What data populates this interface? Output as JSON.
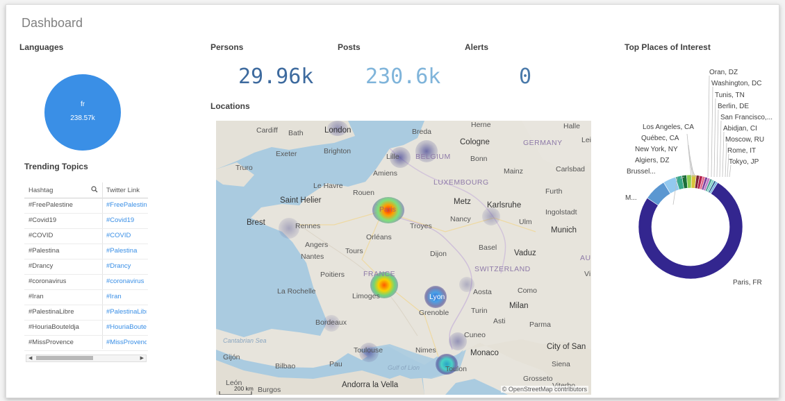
{
  "dashboard": {
    "title": "Dashboard"
  },
  "languages": {
    "heading": "Languages",
    "lang": "fr",
    "value": "238.57k",
    "color": "#3a8fe6"
  },
  "kpis": {
    "persons": {
      "label": "Persons",
      "value": "29.96k",
      "color": "#3d6a9e"
    },
    "posts": {
      "label": "Posts",
      "value": "230.6k",
      "color": "#7fb4da"
    },
    "alerts": {
      "label": "Alerts",
      "value": "0",
      "color": "#4a7aaa"
    }
  },
  "locations": {
    "heading": "Locations",
    "places": [
      "London",
      "Breda",
      "Herne",
      "Halle",
      "Cardiff",
      "Bath",
      "Cologne",
      "GERMANY",
      "Lei",
      "Exeter",
      "Brighton",
      "Lille",
      "BELGIUM",
      "Bonn",
      "Truro",
      "Amiens",
      "Mainz",
      "Carlsbad",
      "Le Havre",
      "LUXEMBOURG",
      "Rouen",
      "Furth",
      "Saint Helier",
      "Paris",
      "Metz",
      "Karlsruhe",
      "Ingolstadt",
      "Brest",
      "Rennes",
      "Troyes",
      "Nancy",
      "Ulm",
      "Munich",
      "Orléans",
      "Angers",
      "Basel",
      "Nantes",
      "Tours",
      "Dijon",
      "Vaduz",
      "AU",
      "FRANCE",
      "SWITZERLAND",
      "Poitiers",
      "Vi",
      "La Rochelle",
      "Limoges",
      "Aosta",
      "Como",
      "Lyon",
      "Grenoble",
      "Milan",
      "Turin",
      "Bordeaux",
      "Asti",
      "Parma",
      "Cantabrian Sea",
      "Cuneo",
      "Toulouse",
      "Nimes",
      "Monaco",
      "City of San",
      "Gijón",
      "Pau",
      "Siena",
      "Bilbao",
      "Gulf of Lion",
      "Toulon",
      "León",
      "Burgos",
      "Andorra la Vella",
      "Grosseto",
      "Viterbo"
    ],
    "scale": "200 km",
    "attribution": "© OpenStreetMap contributors"
  },
  "trending": {
    "heading": "Trending Topics",
    "columns": [
      "Hashtag",
      "Twitter Link"
    ],
    "rows": [
      [
        "#FreePalestine",
        "#FreePalestine"
      ],
      [
        "#Covid19",
        "#Covid19"
      ],
      [
        "#COVID",
        "#COVID"
      ],
      [
        "#Palestina",
        "#Palestina"
      ],
      [
        "#Drancy",
        "#Drancy"
      ],
      [
        "#coronavirus",
        "#coronavirus"
      ],
      [
        "#Iran",
        "#Iran"
      ],
      [
        "#PalestinaLibre",
        "#PalestinaLibre"
      ],
      [
        "#HouriaBouteldja",
        "#HouriaBouteldja"
      ],
      [
        "#MissProvence",
        "#MissProvence"
      ]
    ]
  },
  "places_of_interest": {
    "heading": "Top Places of Interest",
    "labels": [
      "Oran, DZ",
      "Washington, DC",
      "Tunis, TN",
      "Berlin, DE",
      "San Francisco,...",
      "Abidjan, CI",
      "Moscow, RU",
      "Rome, IT",
      "Tokyo, JP",
      "Los Angeles, CA",
      "Québec, CA",
      "New York, NY",
      "Algiers, DZ",
      "Brussel...",
      "M...",
      "Paris, FR"
    ]
  },
  "chart_data": {
    "type": "pie",
    "title": "Top Places of Interest",
    "variant": "donut",
    "categories": [
      "Paris, FR",
      "M...",
      "Brussel...",
      "Algiers, DZ",
      "New York, NY",
      "Québec, CA",
      "Los Angeles, CA",
      "Oran, DZ",
      "Washington, DC",
      "Tunis, TN",
      "Berlin, DE",
      "San Francisco,...",
      "Abidjan, CI",
      "Moscow, RU",
      "Rome, IT",
      "Tokyo, JP"
    ],
    "values": [
      76,
      7,
      4,
      2,
      1.5,
      1.5,
      1.5,
      1,
      1,
      0.8,
      0.8,
      0.8,
      0.7,
      0.7,
      0.6,
      0.6
    ],
    "colors": [
      "#33268f",
      "#5b97d1",
      "#93c9ef",
      "#3aa889",
      "#1d6f39",
      "#8fcf52",
      "#d9c23b",
      "#7a2436",
      "#b5234f",
      "#e06a8a",
      "#7b3f9a",
      "#c07cc7",
      "#4c9e93",
      "#7fd3c7",
      "#2e5f8f",
      "#6fb1e3"
    ]
  }
}
